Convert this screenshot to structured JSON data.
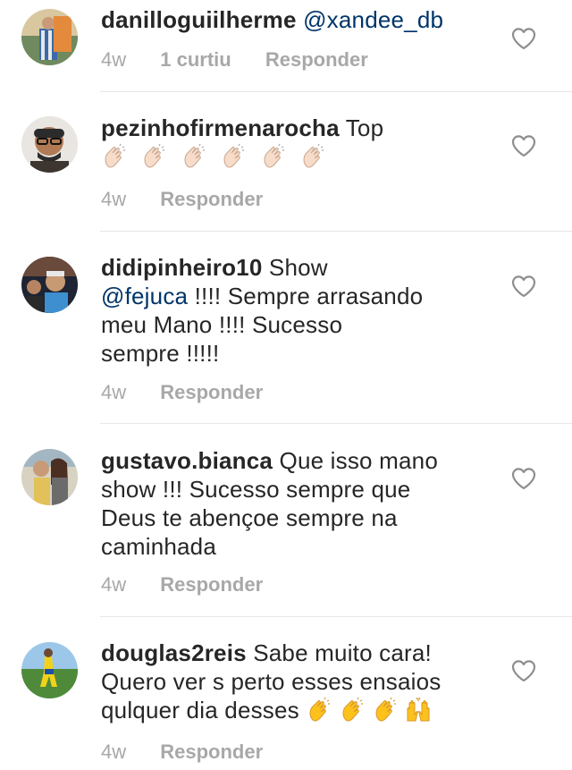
{
  "comments": [
    {
      "username": "danilloguiilherme",
      "text": "",
      "mention": "@xandee_db",
      "time": "4w",
      "likes": "1 curtiu",
      "reply": "Responder",
      "avatar_color": "#6f8a5e"
    },
    {
      "username": "pezinhofirmenarocha",
      "text": "Top",
      "emoji": [
        "clapping-light",
        "clapping-light",
        "clapping-light",
        "clapping-light",
        "clapping-light",
        "clapping-light"
      ],
      "time": "4w",
      "reply": "Responder",
      "avatar_color": "#3c3530"
    },
    {
      "username": "didipinheiro10",
      "text": "Show",
      "mention": "@fejuca",
      "text2": "!!!! Sempre arrasando",
      "text3": "meu Mano !!!! Sucesso",
      "text4": "sempre !!!!!",
      "time": "4w",
      "reply": "Responder",
      "avatar_color": "#2f3b52"
    },
    {
      "username": "gustavo.bianca",
      "text": "Que isso mano",
      "text2": "show !!! Sucesso sempre que",
      "text3": "Deus te abençoe sempre na",
      "text4": "caminhada",
      "time": "4w",
      "reply": "Responder",
      "avatar_color": "#8e7a52"
    },
    {
      "username": "douglas2reis",
      "text": "Sabe muito cara!",
      "text2": "Quero ver s perto esses ensaios",
      "text3": "qulquer dia desses",
      "emoji": [
        "clapping",
        "clapping",
        "clapping",
        "raising-hands"
      ],
      "time": "4w",
      "reply": "Responder",
      "avatar_color": "#4f8a3a"
    }
  ],
  "colors": {
    "text": "#262626",
    "mention": "#003569",
    "meta": "#a8a8a8",
    "divider": "#e6e6e6",
    "heart": "#8e8e8e",
    "emoji_light": "#f6dcc9",
    "emoji_yellow": "#fcc21b"
  }
}
